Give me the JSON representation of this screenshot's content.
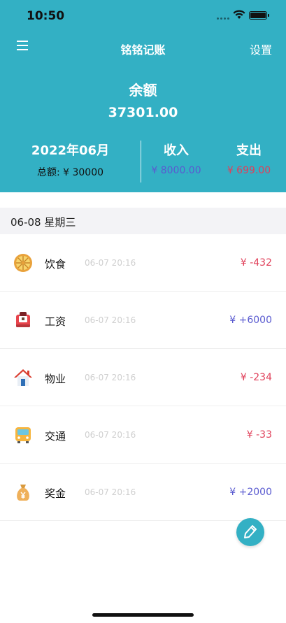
{
  "status_bar": {
    "time": "10:50"
  },
  "header": {
    "title": "铭铭记账",
    "settings_label": "设置",
    "balance_label": "余额",
    "balance_value": "37301.00",
    "month": "2022年06月",
    "budget": "总额: ¥ 30000",
    "income_label": "收入",
    "income_value": "¥ 8000.00",
    "expense_label": "支出",
    "expense_value": "¥ 699.00"
  },
  "date_header": "06-08  星期三",
  "records": [
    {
      "category": "饮食",
      "icon": "food-icon",
      "time": "06-07 20:16",
      "amount": "¥ -432",
      "type": "expense"
    },
    {
      "category": "工资",
      "icon": "salary-icon",
      "time": "06-07 20:16",
      "amount": "¥ +6000",
      "type": "income"
    },
    {
      "category": "物业",
      "icon": "house-icon",
      "time": "06-07 20:16",
      "amount": "¥ -234",
      "type": "expense"
    },
    {
      "category": "交通",
      "icon": "bus-icon",
      "time": "06-07 20:16",
      "amount": "¥ -33",
      "type": "expense"
    },
    {
      "category": "奖金",
      "icon": "money-bag-icon",
      "time": "06-07 20:16",
      "amount": "¥ +2000",
      "type": "income"
    }
  ],
  "colors": {
    "accent": "#33b0c4",
    "income": "#5a5bd0",
    "expense": "#e0405a"
  },
  "fab_icon": "pencil-icon"
}
